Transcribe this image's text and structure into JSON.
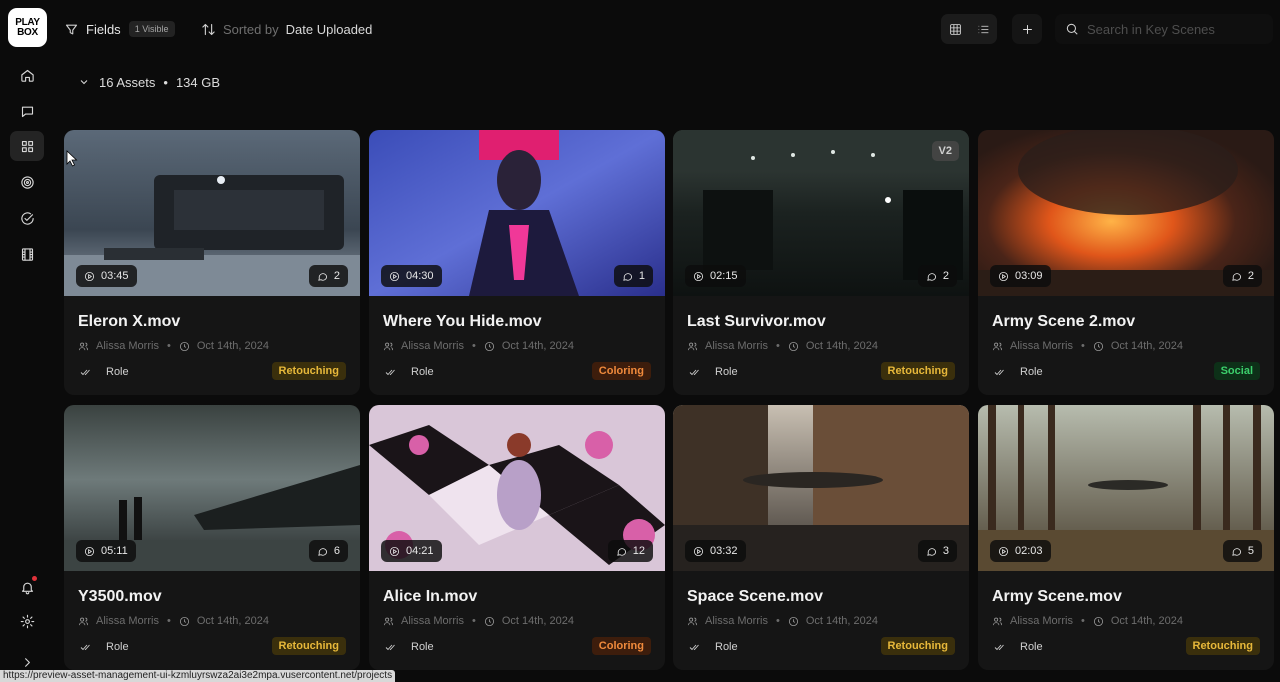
{
  "app": {
    "logo_line1": "PLAY",
    "logo_line2": "BOX"
  },
  "sidebar": {
    "items": [
      {
        "icon": "home-icon"
      },
      {
        "icon": "chat-icon"
      },
      {
        "icon": "grid-icon",
        "active": true
      },
      {
        "icon": "target-icon"
      },
      {
        "icon": "check-circle-icon"
      },
      {
        "icon": "film-icon"
      }
    ],
    "bottom": [
      {
        "icon": "bell-icon",
        "has_notification": true
      },
      {
        "icon": "gear-icon"
      },
      {
        "icon": "chevron-right-icon"
      }
    ]
  },
  "toolbar": {
    "fields_label": "Fields",
    "fields_chip": "1 Visible",
    "sorted_by_label": "Sorted by",
    "sort_value": "Date Uploaded",
    "search_placeholder": "Search in Key Scenes"
  },
  "assets": {
    "count": "16 Assets",
    "size": "134 GB"
  },
  "role_label": "Role",
  "cards": [
    {
      "title": "Eleron X.mov",
      "author": "Alissa Morris",
      "date": "Oct 14th, 2024",
      "duration": "03:45",
      "comments": "2",
      "tag": "Retouching",
      "tag_type": "retouching",
      "badge": ""
    },
    {
      "title": "Where You Hide.mov",
      "author": "Alissa Morris",
      "date": "Oct 14th, 2024",
      "duration": "04:30",
      "comments": "1",
      "tag": "Coloring",
      "tag_type": "coloring",
      "badge": ""
    },
    {
      "title": "Last Survivor.mov",
      "author": "Alissa Morris",
      "date": "Oct 14th, 2024",
      "duration": "02:15",
      "comments": "2",
      "tag": "Retouching",
      "tag_type": "retouching",
      "badge": "V2"
    },
    {
      "title": "Army Scene 2.mov",
      "author": "Alissa Morris",
      "date": "Oct 14th, 2024",
      "duration": "03:09",
      "comments": "2",
      "tag": "Social",
      "tag_type": "social",
      "badge": ""
    },
    {
      "title": "Y3500.mov",
      "author": "Alissa Morris",
      "date": "Oct 14th, 2024",
      "duration": "05:11",
      "comments": "6",
      "tag": "Retouching",
      "tag_type": "retouching",
      "badge": ""
    },
    {
      "title": "Alice In.mov",
      "author": "Alissa Morris",
      "date": "Oct 14th, 2024",
      "duration": "04:21",
      "comments": "12",
      "tag": "Coloring",
      "tag_type": "coloring",
      "badge": ""
    },
    {
      "title": "Space Scene.mov",
      "author": "Alissa Morris",
      "date": "Oct 14th, 2024",
      "duration": "03:32",
      "comments": "3",
      "tag": "Retouching",
      "tag_type": "retouching",
      "badge": ""
    },
    {
      "title": "Army Scene.mov",
      "author": "Alissa Morris",
      "date": "Oct 14th, 2024",
      "duration": "02:03",
      "comments": "5",
      "tag": "Retouching",
      "tag_type": "retouching",
      "badge": ""
    }
  ],
  "status_url": "https://preview-asset-management-ui-kzmluyrswza2ai3e2mpa.vusercontent.net/projects"
}
